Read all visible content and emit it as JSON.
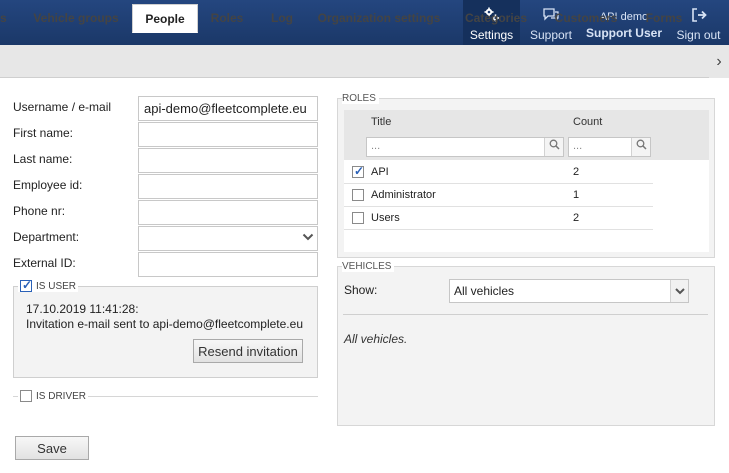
{
  "topnav": {
    "settings": "Settings",
    "support": "Support",
    "user_name": "API demo",
    "support_user": "Support User",
    "sign_out": "Sign out"
  },
  "tabs": [
    "s",
    "Vehicle groups",
    "People",
    "Roles",
    "Log",
    "Organization settings",
    "Categories",
    "Customers",
    "Forms"
  ],
  "active_tab": "People",
  "form": {
    "username_label": "Username / e-mail",
    "username_value": "api-demo@fleetcomplete.eu",
    "first_name_label": "First name:",
    "last_name_label": "Last name:",
    "employee_id_label": "Employee id:",
    "phone_label": "Phone nr:",
    "department_label": "Department:",
    "external_id_label": "External ID:"
  },
  "is_user": {
    "label": "IS USER",
    "checked": true,
    "timestamp": "17.10.2019 11:41:28:",
    "message": "Invitation e-mail sent to api-demo@fleetcomplete.eu",
    "resend_label": "Resend invitation"
  },
  "is_driver": {
    "label": "IS DRIVER",
    "checked": false
  },
  "save_label": "Save",
  "roles": {
    "title": "ROLES",
    "col_title": "Title",
    "col_count": "Count",
    "filter_placeholder": "...",
    "rows": [
      {
        "title": "API",
        "count": "2",
        "checked": true
      },
      {
        "title": "Administrator",
        "count": "1",
        "checked": false
      },
      {
        "title": "Users",
        "count": "2",
        "checked": false
      }
    ]
  },
  "vehicles": {
    "title": "VEHICLES",
    "show_label": "Show:",
    "show_value": "All vehicles",
    "note": "All vehicles."
  },
  "colors": {
    "header": "#1f3d72",
    "accent": "#2a61b8"
  }
}
